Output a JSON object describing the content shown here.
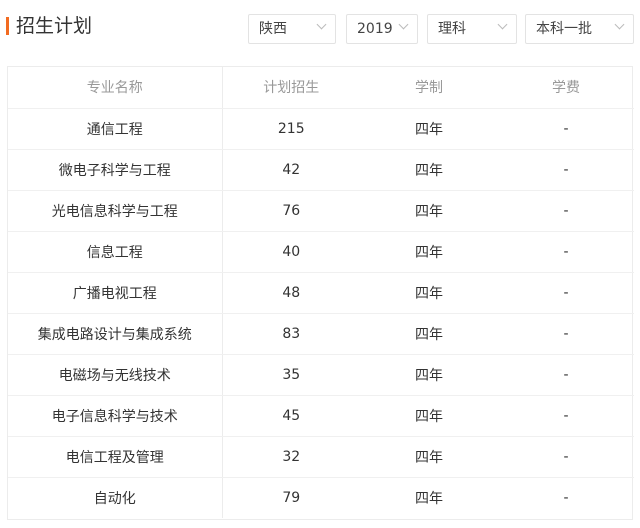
{
  "header": {
    "title": "招生计划"
  },
  "filters": {
    "province": "陕西",
    "year": "2019",
    "subject": "理科",
    "batch": "本科一批"
  },
  "table": {
    "columns": [
      "专业名称",
      "计划招生",
      "学制",
      "学费"
    ],
    "rows": [
      {
        "major": "通信工程",
        "plan": "215",
        "duration": "四年",
        "fee": "-"
      },
      {
        "major": "微电子科学与工程",
        "plan": "42",
        "duration": "四年",
        "fee": "-"
      },
      {
        "major": "光电信息科学与工程",
        "plan": "76",
        "duration": "四年",
        "fee": "-"
      },
      {
        "major": "信息工程",
        "plan": "40",
        "duration": "四年",
        "fee": "-"
      },
      {
        "major": "广播电视工程",
        "plan": "48",
        "duration": "四年",
        "fee": "-"
      },
      {
        "major": "集成电路设计与集成系统",
        "plan": "83",
        "duration": "四年",
        "fee": "-"
      },
      {
        "major": "电磁场与无线技术",
        "plan": "35",
        "duration": "四年",
        "fee": "-"
      },
      {
        "major": "电子信息科学与技术",
        "plan": "45",
        "duration": "四年",
        "fee": "-"
      },
      {
        "major": "电信工程及管理",
        "plan": "32",
        "duration": "四年",
        "fee": "-"
      },
      {
        "major": "自动化",
        "plan": "79",
        "duration": "四年",
        "fee": "-"
      }
    ]
  },
  "colors": {
    "accent": "#f26b21"
  }
}
